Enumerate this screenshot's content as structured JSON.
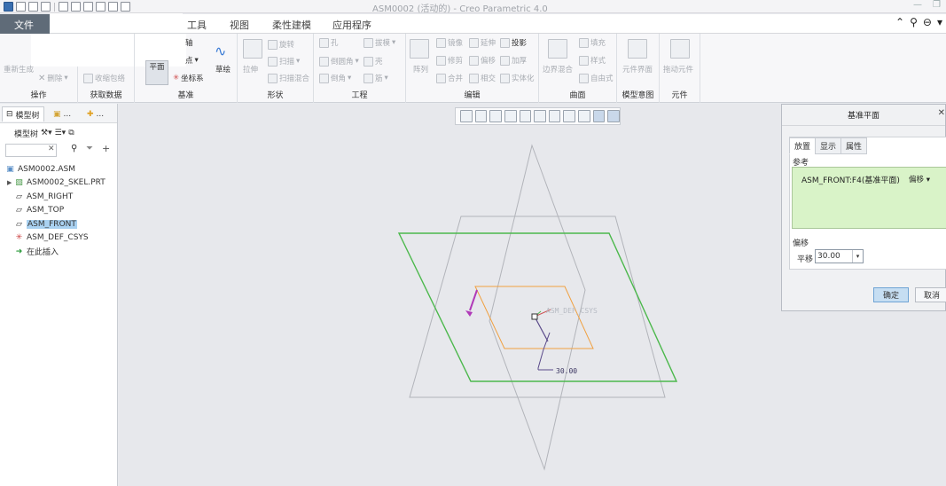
{
  "window": {
    "title": "ASM0002 (活动的) - Creo Parametric 4.0"
  },
  "menu": {
    "file": "文件",
    "tabs": [
      "工具",
      "视图",
      "柔性建模",
      "应用程序"
    ]
  },
  "ribbon": {
    "operations": {
      "regenerate": "重新生成",
      "delete": "删除",
      "label": "操作"
    },
    "get_data": {
      "shrinkwrap": "收缩包络",
      "label": "获取数据"
    },
    "datum": {
      "plane": "平面",
      "axis": "轴",
      "point": "点",
      "csys": "坐标系",
      "sketch": "草绘",
      "label": "基准"
    },
    "shapes": {
      "extrude": "拉伸",
      "revolve": "旋转",
      "sweep": "扫描",
      "swept_blend": "扫描混合",
      "label": "形状"
    },
    "engineering": {
      "hole": "孔",
      "draft": "拔模",
      "round": "倒圆角",
      "shell": "壳",
      "chamfer": "倒角",
      "rib": "筋",
      "label": "工程"
    },
    "editing": {
      "pattern": "阵列",
      "mirror": "镜像",
      "extend": "延伸",
      "project": "投影",
      "trim": "修剪",
      "offset": "偏移",
      "thicken": "加厚",
      "merge": "合并",
      "intersect": "相交",
      "solidify": "实体化",
      "label": "编辑"
    },
    "surfaces": {
      "boundary_blend": "边界混合",
      "fill": "填充",
      "style": "样式",
      "freestyle": "自由式",
      "label": "曲面"
    },
    "model_intent": {
      "component_interface": "元件界面",
      "label": "模型意图"
    },
    "components": {
      "drag_components": "拖动元件",
      "label": "元件"
    }
  },
  "left_panel": {
    "tabs": [
      "模型树",
      "...",
      "..."
    ],
    "tree_label": "模型树",
    "tree": [
      {
        "label": "ASM0002.ASM",
        "icon": "assembly-icon"
      },
      {
        "label": "ASM0002_SKEL.PRT",
        "icon": "skeleton-part-icon"
      },
      {
        "label": "ASM_RIGHT",
        "icon": "datum-plane-icon"
      },
      {
        "label": "ASM_TOP",
        "icon": "datum-plane-icon"
      },
      {
        "label": "ASM_FRONT",
        "icon": "datum-plane-icon",
        "selected": true
      },
      {
        "label": "ASM_DEF_CSYS",
        "icon": "csys-icon"
      },
      {
        "label": "在此插入",
        "icon": "insert-here-icon"
      }
    ]
  },
  "graphics": {
    "csys_label": "ASM_DEF_CSYS",
    "dimension": "30.00"
  },
  "dialog": {
    "title": "基准平面",
    "tabs": [
      "放置",
      "显示",
      "属性"
    ],
    "references_label": "参考",
    "reference": "ASM_FRONT:F4(基准平面)",
    "constraint": "偏移",
    "offset_label": "偏移",
    "translation_label": "平移",
    "translation_value": "30.00",
    "ok": "确定",
    "cancel": "取消"
  },
  "colors": {
    "selection_highlight": "#a9d1f1",
    "reference_box": "#d9f3c8",
    "preview_plane": "#4cb84c",
    "new_plane": "#f0a040",
    "file_tab": "#5f6b78"
  }
}
